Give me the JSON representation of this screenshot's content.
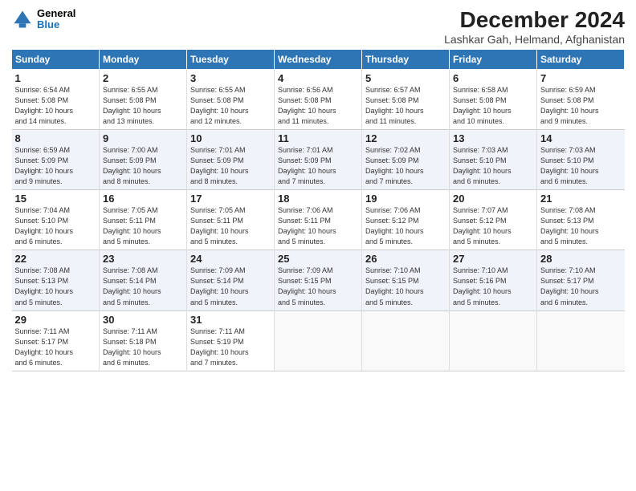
{
  "header": {
    "logo_general": "General",
    "logo_blue": "Blue",
    "title": "December 2024",
    "location": "Lashkar Gah, Helmand, Afghanistan"
  },
  "days_of_week": [
    "Sunday",
    "Monday",
    "Tuesday",
    "Wednesday",
    "Thursday",
    "Friday",
    "Saturday"
  ],
  "weeks": [
    [
      {
        "day": "1",
        "lines": [
          "Sunrise: 6:54 AM",
          "Sunset: 5:08 PM",
          "Daylight: 10 hours",
          "and 14 minutes."
        ]
      },
      {
        "day": "2",
        "lines": [
          "Sunrise: 6:55 AM",
          "Sunset: 5:08 PM",
          "Daylight: 10 hours",
          "and 13 minutes."
        ]
      },
      {
        "day": "3",
        "lines": [
          "Sunrise: 6:55 AM",
          "Sunset: 5:08 PM",
          "Daylight: 10 hours",
          "and 12 minutes."
        ]
      },
      {
        "day": "4",
        "lines": [
          "Sunrise: 6:56 AM",
          "Sunset: 5:08 PM",
          "Daylight: 10 hours",
          "and 11 minutes."
        ]
      },
      {
        "day": "5",
        "lines": [
          "Sunrise: 6:57 AM",
          "Sunset: 5:08 PM",
          "Daylight: 10 hours",
          "and 11 minutes."
        ]
      },
      {
        "day": "6",
        "lines": [
          "Sunrise: 6:58 AM",
          "Sunset: 5:08 PM",
          "Daylight: 10 hours",
          "and 10 minutes."
        ]
      },
      {
        "day": "7",
        "lines": [
          "Sunrise: 6:59 AM",
          "Sunset: 5:08 PM",
          "Daylight: 10 hours",
          "and 9 minutes."
        ]
      }
    ],
    [
      {
        "day": "8",
        "lines": [
          "Sunrise: 6:59 AM",
          "Sunset: 5:09 PM",
          "Daylight: 10 hours",
          "and 9 minutes."
        ]
      },
      {
        "day": "9",
        "lines": [
          "Sunrise: 7:00 AM",
          "Sunset: 5:09 PM",
          "Daylight: 10 hours",
          "and 8 minutes."
        ]
      },
      {
        "day": "10",
        "lines": [
          "Sunrise: 7:01 AM",
          "Sunset: 5:09 PM",
          "Daylight: 10 hours",
          "and 8 minutes."
        ]
      },
      {
        "day": "11",
        "lines": [
          "Sunrise: 7:01 AM",
          "Sunset: 5:09 PM",
          "Daylight: 10 hours",
          "and 7 minutes."
        ]
      },
      {
        "day": "12",
        "lines": [
          "Sunrise: 7:02 AM",
          "Sunset: 5:09 PM",
          "Daylight: 10 hours",
          "and 7 minutes."
        ]
      },
      {
        "day": "13",
        "lines": [
          "Sunrise: 7:03 AM",
          "Sunset: 5:10 PM",
          "Daylight: 10 hours",
          "and 6 minutes."
        ]
      },
      {
        "day": "14",
        "lines": [
          "Sunrise: 7:03 AM",
          "Sunset: 5:10 PM",
          "Daylight: 10 hours",
          "and 6 minutes."
        ]
      }
    ],
    [
      {
        "day": "15",
        "lines": [
          "Sunrise: 7:04 AM",
          "Sunset: 5:10 PM",
          "Daylight: 10 hours",
          "and 6 minutes."
        ]
      },
      {
        "day": "16",
        "lines": [
          "Sunrise: 7:05 AM",
          "Sunset: 5:11 PM",
          "Daylight: 10 hours",
          "and 5 minutes."
        ]
      },
      {
        "day": "17",
        "lines": [
          "Sunrise: 7:05 AM",
          "Sunset: 5:11 PM",
          "Daylight: 10 hours",
          "and 5 minutes."
        ]
      },
      {
        "day": "18",
        "lines": [
          "Sunrise: 7:06 AM",
          "Sunset: 5:11 PM",
          "Daylight: 10 hours",
          "and 5 minutes."
        ]
      },
      {
        "day": "19",
        "lines": [
          "Sunrise: 7:06 AM",
          "Sunset: 5:12 PM",
          "Daylight: 10 hours",
          "and 5 minutes."
        ]
      },
      {
        "day": "20",
        "lines": [
          "Sunrise: 7:07 AM",
          "Sunset: 5:12 PM",
          "Daylight: 10 hours",
          "and 5 minutes."
        ]
      },
      {
        "day": "21",
        "lines": [
          "Sunrise: 7:08 AM",
          "Sunset: 5:13 PM",
          "Daylight: 10 hours",
          "and 5 minutes."
        ]
      }
    ],
    [
      {
        "day": "22",
        "lines": [
          "Sunrise: 7:08 AM",
          "Sunset: 5:13 PM",
          "Daylight: 10 hours",
          "and 5 minutes."
        ]
      },
      {
        "day": "23",
        "lines": [
          "Sunrise: 7:08 AM",
          "Sunset: 5:14 PM",
          "Daylight: 10 hours",
          "and 5 minutes."
        ]
      },
      {
        "day": "24",
        "lines": [
          "Sunrise: 7:09 AM",
          "Sunset: 5:14 PM",
          "Daylight: 10 hours",
          "and 5 minutes."
        ]
      },
      {
        "day": "25",
        "lines": [
          "Sunrise: 7:09 AM",
          "Sunset: 5:15 PM",
          "Daylight: 10 hours",
          "and 5 minutes."
        ]
      },
      {
        "day": "26",
        "lines": [
          "Sunrise: 7:10 AM",
          "Sunset: 5:15 PM",
          "Daylight: 10 hours",
          "and 5 minutes."
        ]
      },
      {
        "day": "27",
        "lines": [
          "Sunrise: 7:10 AM",
          "Sunset: 5:16 PM",
          "Daylight: 10 hours",
          "and 5 minutes."
        ]
      },
      {
        "day": "28",
        "lines": [
          "Sunrise: 7:10 AM",
          "Sunset: 5:17 PM",
          "Daylight: 10 hours",
          "and 6 minutes."
        ]
      }
    ],
    [
      {
        "day": "29",
        "lines": [
          "Sunrise: 7:11 AM",
          "Sunset: 5:17 PM",
          "Daylight: 10 hours",
          "and 6 minutes."
        ]
      },
      {
        "day": "30",
        "lines": [
          "Sunrise: 7:11 AM",
          "Sunset: 5:18 PM",
          "Daylight: 10 hours",
          "and 6 minutes."
        ]
      },
      {
        "day": "31",
        "lines": [
          "Sunrise: 7:11 AM",
          "Sunset: 5:19 PM",
          "Daylight: 10 hours",
          "and 7 minutes."
        ]
      },
      null,
      null,
      null,
      null
    ]
  ]
}
